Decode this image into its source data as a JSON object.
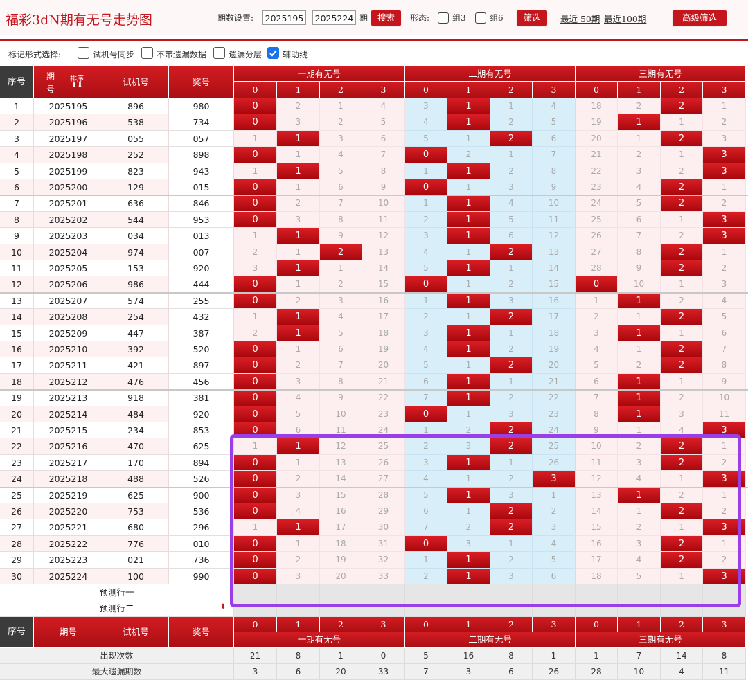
{
  "app_title": "福彩3dN期有无号走势图",
  "toolbar": {
    "period_label": "期数设置:",
    "period_start": "2025195",
    "dash": "-",
    "period_end": "2025224",
    "period_unit": "期",
    "search_btn": "搜索",
    "form_label": "形态:",
    "group3": "组3",
    "group6": "组6",
    "filter_btn": "筛选",
    "recent50": "最近 50期",
    "recent100": "最近100期",
    "adv_btn": "高级筛选"
  },
  "markbar": {
    "label": "标记形式选择:",
    "options": [
      {
        "label": "试机号同步",
        "checked": false
      },
      {
        "label": "不带遗漏数据",
        "checked": false
      },
      {
        "label": "遗漏分层",
        "checked": false
      },
      {
        "label": "辅助线",
        "checked": true
      }
    ]
  },
  "headers": {
    "seq": "序号",
    "period_a": "期",
    "period_b": "号",
    "sort": "排序",
    "period": "期号",
    "test": "试机号",
    "draw": "奖号",
    "groups": [
      "一期有无号",
      "二期有无号",
      "三期有无号"
    ],
    "digits": [
      "0",
      "1",
      "2",
      "3"
    ]
  },
  "rows": [
    {
      "seq": "1",
      "period": "2025195",
      "test": "896",
      "draw": "980",
      "cells": [
        [
          "0",
          "2",
          "1",
          "4"
        ],
        [
          "3",
          "1",
          "1",
          "4"
        ],
        [
          "18",
          "2",
          "2",
          "1"
        ]
      ],
      "hits": [
        [
          1,
          0,
          0,
          0
        ],
        [
          0,
          1,
          0,
          0
        ],
        [
          0,
          0,
          1,
          0
        ]
      ]
    },
    {
      "seq": "2",
      "period": "2025196",
      "test": "538",
      "draw": "734",
      "cells": [
        [
          "0",
          "3",
          "2",
          "5"
        ],
        [
          "4",
          "1",
          "2",
          "5"
        ],
        [
          "19",
          "1",
          "1",
          "2"
        ]
      ],
      "hits": [
        [
          1,
          0,
          0,
          0
        ],
        [
          0,
          1,
          0,
          0
        ],
        [
          0,
          1,
          0,
          0
        ]
      ]
    },
    {
      "seq": "3",
      "period": "2025197",
      "test": "055",
      "draw": "057",
      "cells": [
        [
          "1",
          "1",
          "3",
          "6"
        ],
        [
          "5",
          "1",
          "2",
          "6"
        ],
        [
          "20",
          "1",
          "2",
          "3"
        ]
      ],
      "hits": [
        [
          0,
          1,
          0,
          0
        ],
        [
          0,
          0,
          1,
          0
        ],
        [
          0,
          0,
          1,
          0
        ]
      ]
    },
    {
      "seq": "4",
      "period": "2025198",
      "test": "252",
      "draw": "898",
      "cells": [
        [
          "0",
          "1",
          "4",
          "7"
        ],
        [
          "0",
          "2",
          "1",
          "7"
        ],
        [
          "21",
          "2",
          "1",
          "3"
        ]
      ],
      "hits": [
        [
          1,
          0,
          0,
          0
        ],
        [
          1,
          0,
          0,
          0
        ],
        [
          0,
          0,
          0,
          1
        ]
      ]
    },
    {
      "seq": "5",
      "period": "2025199",
      "test": "823",
      "draw": "943",
      "cells": [
        [
          "1",
          "1",
          "5",
          "8"
        ],
        [
          "1",
          "1",
          "2",
          "8"
        ],
        [
          "22",
          "3",
          "2",
          "3"
        ]
      ],
      "hits": [
        [
          0,
          1,
          0,
          0
        ],
        [
          0,
          1,
          0,
          0
        ],
        [
          0,
          0,
          0,
          1
        ]
      ]
    },
    {
      "seq": "6",
      "period": "2025200",
      "test": "129",
      "draw": "015",
      "cells": [
        [
          "0",
          "1",
          "6",
          "9"
        ],
        [
          "0",
          "1",
          "3",
          "9"
        ],
        [
          "23",
          "4",
          "2",
          "1"
        ]
      ],
      "hits": [
        [
          1,
          0,
          0,
          0
        ],
        [
          1,
          0,
          0,
          0
        ],
        [
          0,
          0,
          1,
          0
        ]
      ]
    },
    {
      "seq": "7",
      "period": "2025201",
      "test": "636",
      "draw": "846",
      "cells": [
        [
          "0",
          "2",
          "7",
          "10"
        ],
        [
          "1",
          "1",
          "4",
          "10"
        ],
        [
          "24",
          "5",
          "2",
          "2"
        ]
      ],
      "hits": [
        [
          1,
          0,
          0,
          0
        ],
        [
          0,
          1,
          0,
          0
        ],
        [
          0,
          0,
          1,
          0
        ]
      ]
    },
    {
      "seq": "8",
      "period": "2025202",
      "test": "544",
      "draw": "953",
      "cells": [
        [
          "0",
          "3",
          "8",
          "11"
        ],
        [
          "2",
          "1",
          "5",
          "11"
        ],
        [
          "25",
          "6",
          "1",
          "3"
        ]
      ],
      "hits": [
        [
          1,
          0,
          0,
          0
        ],
        [
          0,
          1,
          0,
          0
        ],
        [
          0,
          0,
          0,
          1
        ]
      ]
    },
    {
      "seq": "9",
      "period": "2025203",
      "test": "034",
      "draw": "013",
      "cells": [
        [
          "1",
          "1",
          "9",
          "12"
        ],
        [
          "3",
          "1",
          "6",
          "12"
        ],
        [
          "26",
          "7",
          "2",
          "3"
        ]
      ],
      "hits": [
        [
          0,
          1,
          0,
          0
        ],
        [
          0,
          1,
          0,
          0
        ],
        [
          0,
          0,
          0,
          1
        ]
      ]
    },
    {
      "seq": "10",
      "period": "2025204",
      "test": "974",
      "draw": "007",
      "cells": [
        [
          "2",
          "1",
          "2",
          "13"
        ],
        [
          "4",
          "1",
          "2",
          "13"
        ],
        [
          "27",
          "8",
          "2",
          "1"
        ]
      ],
      "hits": [
        [
          0,
          0,
          1,
          0
        ],
        [
          0,
          0,
          1,
          0
        ],
        [
          0,
          0,
          1,
          0
        ]
      ]
    },
    {
      "seq": "11",
      "period": "2025205",
      "test": "153",
      "draw": "920",
      "cells": [
        [
          "3",
          "1",
          "1",
          "14"
        ],
        [
          "5",
          "1",
          "1",
          "14"
        ],
        [
          "28",
          "9",
          "2",
          "2"
        ]
      ],
      "hits": [
        [
          0,
          1,
          0,
          0
        ],
        [
          0,
          1,
          0,
          0
        ],
        [
          0,
          0,
          1,
          0
        ]
      ]
    },
    {
      "seq": "12",
      "period": "2025206",
      "test": "986",
      "draw": "444",
      "cells": [
        [
          "0",
          "1",
          "2",
          "15"
        ],
        [
          "0",
          "1",
          "2",
          "15"
        ],
        [
          "0",
          "10",
          "1",
          "3"
        ]
      ],
      "hits": [
        [
          1,
          0,
          0,
          0
        ],
        [
          1,
          0,
          0,
          0
        ],
        [
          1,
          0,
          0,
          0
        ]
      ]
    },
    {
      "seq": "13",
      "period": "2025207",
      "test": "574",
      "draw": "255",
      "cells": [
        [
          "0",
          "2",
          "3",
          "16"
        ],
        [
          "1",
          "1",
          "3",
          "16"
        ],
        [
          "1",
          "1",
          "2",
          "4"
        ]
      ],
      "hits": [
        [
          1,
          0,
          0,
          0
        ],
        [
          0,
          1,
          0,
          0
        ],
        [
          0,
          1,
          0,
          0
        ]
      ]
    },
    {
      "seq": "14",
      "period": "2025208",
      "test": "254",
      "draw": "432",
      "cells": [
        [
          "1",
          "1",
          "4",
          "17"
        ],
        [
          "2",
          "1",
          "2",
          "17"
        ],
        [
          "2",
          "1",
          "2",
          "5"
        ]
      ],
      "hits": [
        [
          0,
          1,
          0,
          0
        ],
        [
          0,
          0,
          1,
          0
        ],
        [
          0,
          0,
          1,
          0
        ]
      ]
    },
    {
      "seq": "15",
      "period": "2025209",
      "test": "447",
      "draw": "387",
      "cells": [
        [
          "2",
          "1",
          "5",
          "18"
        ],
        [
          "3",
          "1",
          "1",
          "18"
        ],
        [
          "3",
          "1",
          "1",
          "6"
        ]
      ],
      "hits": [
        [
          0,
          1,
          0,
          0
        ],
        [
          0,
          1,
          0,
          0
        ],
        [
          0,
          1,
          0,
          0
        ]
      ]
    },
    {
      "seq": "16",
      "period": "2025210",
      "test": "392",
      "draw": "520",
      "cells": [
        [
          "0",
          "1",
          "6",
          "19"
        ],
        [
          "4",
          "1",
          "2",
          "19"
        ],
        [
          "4",
          "1",
          "2",
          "7"
        ]
      ],
      "hits": [
        [
          1,
          0,
          0,
          0
        ],
        [
          0,
          1,
          0,
          0
        ],
        [
          0,
          0,
          1,
          0
        ]
      ]
    },
    {
      "seq": "17",
      "period": "2025211",
      "test": "421",
      "draw": "897",
      "cells": [
        [
          "0",
          "2",
          "7",
          "20"
        ],
        [
          "5",
          "1",
          "2",
          "20"
        ],
        [
          "5",
          "2",
          "2",
          "8"
        ]
      ],
      "hits": [
        [
          1,
          0,
          0,
          0
        ],
        [
          0,
          0,
          1,
          0
        ],
        [
          0,
          0,
          1,
          0
        ]
      ]
    },
    {
      "seq": "18",
      "period": "2025212",
      "test": "476",
      "draw": "456",
      "cells": [
        [
          "0",
          "3",
          "8",
          "21"
        ],
        [
          "6",
          "1",
          "1",
          "21"
        ],
        [
          "6",
          "1",
          "1",
          "9"
        ]
      ],
      "hits": [
        [
          1,
          0,
          0,
          0
        ],
        [
          0,
          1,
          0,
          0
        ],
        [
          0,
          1,
          0,
          0
        ]
      ]
    },
    {
      "seq": "19",
      "period": "2025213",
      "test": "918",
      "draw": "381",
      "cells": [
        [
          "0",
          "4",
          "9",
          "22"
        ],
        [
          "7",
          "1",
          "2",
          "22"
        ],
        [
          "7",
          "1",
          "2",
          "10"
        ]
      ],
      "hits": [
        [
          1,
          0,
          0,
          0
        ],
        [
          0,
          1,
          0,
          0
        ],
        [
          0,
          1,
          0,
          0
        ]
      ]
    },
    {
      "seq": "20",
      "period": "2025214",
      "test": "484",
      "draw": "920",
      "cells": [
        [
          "0",
          "5",
          "10",
          "23"
        ],
        [
          "0",
          "1",
          "3",
          "23"
        ],
        [
          "8",
          "1",
          "3",
          "11"
        ]
      ],
      "hits": [
        [
          1,
          0,
          0,
          0
        ],
        [
          1,
          0,
          0,
          0
        ],
        [
          0,
          1,
          0,
          0
        ]
      ]
    },
    {
      "seq": "21",
      "period": "2025215",
      "test": "234",
      "draw": "853",
      "cells": [
        [
          "0",
          "6",
          "11",
          "24"
        ],
        [
          "1",
          "2",
          "2",
          "24"
        ],
        [
          "9",
          "1",
          "4",
          "3"
        ]
      ],
      "hits": [
        [
          1,
          0,
          0,
          0
        ],
        [
          0,
          0,
          1,
          0
        ],
        [
          0,
          0,
          0,
          1
        ]
      ]
    },
    {
      "seq": "22",
      "period": "2025216",
      "test": "470",
      "draw": "625",
      "cells": [
        [
          "1",
          "1",
          "12",
          "25"
        ],
        [
          "2",
          "3",
          "2",
          "25"
        ],
        [
          "10",
          "2",
          "2",
          "1"
        ]
      ],
      "hits": [
        [
          0,
          1,
          0,
          0
        ],
        [
          0,
          0,
          1,
          0
        ],
        [
          0,
          0,
          1,
          0
        ]
      ]
    },
    {
      "seq": "23",
      "period": "2025217",
      "test": "170",
      "draw": "894",
      "cells": [
        [
          "0",
          "1",
          "13",
          "26"
        ],
        [
          "3",
          "1",
          "1",
          "26"
        ],
        [
          "11",
          "3",
          "2",
          "2"
        ]
      ],
      "hits": [
        [
          1,
          0,
          0,
          0
        ],
        [
          0,
          1,
          0,
          0
        ],
        [
          0,
          0,
          1,
          0
        ]
      ]
    },
    {
      "seq": "24",
      "period": "2025218",
      "test": "488",
      "draw": "526",
      "cells": [
        [
          "0",
          "2",
          "14",
          "27"
        ],
        [
          "4",
          "1",
          "2",
          "3"
        ],
        [
          "12",
          "4",
          "1",
          "3"
        ]
      ],
      "hits": [
        [
          1,
          0,
          0,
          0
        ],
        [
          0,
          0,
          0,
          1
        ],
        [
          0,
          0,
          0,
          1
        ]
      ]
    },
    {
      "seq": "25",
      "period": "2025219",
      "test": "625",
      "draw": "900",
      "cells": [
        [
          "0",
          "3",
          "15",
          "28"
        ],
        [
          "5",
          "1",
          "3",
          "1"
        ],
        [
          "13",
          "1",
          "2",
          "1"
        ]
      ],
      "hits": [
        [
          1,
          0,
          0,
          0
        ],
        [
          0,
          1,
          0,
          0
        ],
        [
          0,
          1,
          0,
          0
        ]
      ]
    },
    {
      "seq": "26",
      "period": "2025220",
      "test": "753",
      "draw": "536",
      "cells": [
        [
          "0",
          "4",
          "16",
          "29"
        ],
        [
          "6",
          "1",
          "2",
          "2"
        ],
        [
          "14",
          "1",
          "2",
          "2"
        ]
      ],
      "hits": [
        [
          1,
          0,
          0,
          0
        ],
        [
          0,
          0,
          1,
          0
        ],
        [
          0,
          0,
          1,
          0
        ]
      ]
    },
    {
      "seq": "27",
      "period": "2025221",
      "test": "680",
      "draw": "296",
      "cells": [
        [
          "1",
          "1",
          "17",
          "30"
        ],
        [
          "7",
          "2",
          "2",
          "3"
        ],
        [
          "15",
          "2",
          "1",
          "3"
        ]
      ],
      "hits": [
        [
          0,
          1,
          0,
          0
        ],
        [
          0,
          0,
          1,
          0
        ],
        [
          0,
          0,
          0,
          1
        ]
      ]
    },
    {
      "seq": "28",
      "period": "2025222",
      "test": "776",
      "draw": "010",
      "cells": [
        [
          "0",
          "1",
          "18",
          "31"
        ],
        [
          "0",
          "3",
          "1",
          "4"
        ],
        [
          "16",
          "3",
          "2",
          "1"
        ]
      ],
      "hits": [
        [
          1,
          0,
          0,
          0
        ],
        [
          1,
          0,
          0,
          0
        ],
        [
          0,
          0,
          1,
          0
        ]
      ]
    },
    {
      "seq": "29",
      "period": "2025223",
      "test": "021",
      "draw": "736",
      "cells": [
        [
          "0",
          "2",
          "19",
          "32"
        ],
        [
          "1",
          "1",
          "2",
          "5"
        ],
        [
          "17",
          "4",
          "2",
          "2"
        ]
      ],
      "hits": [
        [
          1,
          0,
          0,
          0
        ],
        [
          0,
          1,
          0,
          0
        ],
        [
          0,
          0,
          1,
          0
        ]
      ]
    },
    {
      "seq": "30",
      "period": "2025224",
      "test": "100",
      "draw": "990",
      "cells": [
        [
          "0",
          "3",
          "20",
          "33"
        ],
        [
          "2",
          "1",
          "3",
          "6"
        ],
        [
          "18",
          "5",
          "1",
          "3"
        ]
      ],
      "hits": [
        [
          1,
          0,
          0,
          0
        ],
        [
          0,
          1,
          0,
          0
        ],
        [
          0,
          0,
          0,
          1
        ]
      ]
    }
  ],
  "predict_rows": [
    "预测行一",
    "预测行二"
  ],
  "stats": [
    {
      "label": "出现次数",
      "values": [
        "21",
        "8",
        "1",
        "0",
        "5",
        "16",
        "8",
        "1",
        "1",
        "7",
        "14",
        "8"
      ]
    },
    {
      "label": "最大遗漏期数",
      "values": [
        "3",
        "6",
        "20",
        "33",
        "7",
        "3",
        "6",
        "26",
        "28",
        "10",
        "4",
        "11"
      ]
    }
  ],
  "colors": {
    "accent": "#c4161c",
    "mid_group_bg": "#d8eef8",
    "highlight_box": "#9a3ee8"
  }
}
